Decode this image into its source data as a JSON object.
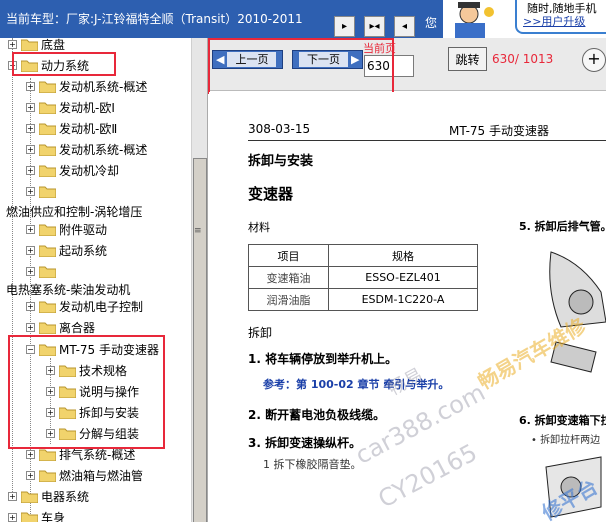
{
  "header": {
    "car_label": "当前车型：",
    "car_value": "厂家:J-江铃福特全顺（Transit）2010-2011",
    "about_text": "您",
    "ad_line1": "随时,随地手机",
    "ad_line2": ">>用户升级"
  },
  "toolbar_buttons": {
    "first_icon": "▸",
    "middle_icon": "▸◂",
    "last_icon": "◂"
  },
  "sidebar": {
    "items": [
      {
        "label": "底盘",
        "expander": "+"
      },
      {
        "label": "动力系统",
        "expander": "−"
      },
      {
        "label": "发动机系统-概述",
        "expander": "+"
      },
      {
        "label": "发动机-欧Ⅰ",
        "expander": "+"
      },
      {
        "label": "发动机-欧Ⅱ",
        "expander": "+"
      },
      {
        "label": "发动机系统-概述",
        "expander": "+"
      },
      {
        "label": "发动机冷却",
        "expander": "+"
      },
      {
        "label": "",
        "expander": "+"
      },
      {
        "label": "燃油供应和控制-涡轮增压",
        "expander": ""
      },
      {
        "label": "附件驱动",
        "expander": "+"
      },
      {
        "label": "起动系统",
        "expander": "+"
      },
      {
        "label": "",
        "expander": "+"
      },
      {
        "label": "电热塞系统-柴油发动机",
        "expander": ""
      },
      {
        "label": "发动机电子控制",
        "expander": "+"
      },
      {
        "label": "离合器",
        "expander": "+"
      },
      {
        "label": "MT-75 手动变速器",
        "expander": "−"
      },
      {
        "label": "技术规格",
        "expander": "+"
      },
      {
        "label": "说明与操作",
        "expander": "+"
      },
      {
        "label": "拆卸与安装",
        "expander": "+"
      },
      {
        "label": "分解与组装",
        "expander": "+"
      },
      {
        "label": "排气系统-概述",
        "expander": "+"
      },
      {
        "label": "燃油箱与燃油管",
        "expander": "+"
      },
      {
        "label": "电器系统",
        "expander": "+"
      },
      {
        "label": "车身",
        "expander": "+"
      }
    ]
  },
  "toolbar": {
    "prev_label": "上一页",
    "next_label": "下一页",
    "page_caption": "当前页",
    "page_value": "630",
    "jump_label": "跳转",
    "page_count": "630/ 1013",
    "zoom_icon": "+"
  },
  "document": {
    "doc_number": "308-03-15",
    "header_title": "MT-75 手动变速器",
    "section_title": "拆卸与安装",
    "component_title": "变速器",
    "materials_heading": "材料",
    "table_headers": [
      "项目",
      "规格"
    ],
    "table_rows": [
      [
        "变速箱油",
        "ESSO-EZL401"
      ],
      [
        "润滑油脂",
        "ESDM-1C220-A"
      ]
    ],
    "removal_heading": "拆卸",
    "step1": "1. 将车辆停放到举升机上。",
    "step1_ref": "参考：第 100-02 章节 牵引与举升。",
    "step2": "2. 断开蓄电池负极线缆。",
    "step3": "3. 拆卸变速操纵杆。",
    "step3_sub": "1 拆下橡胶隔音垫。",
    "right_step5": "5. 拆卸后排气管。",
    "right_step6": "6. 拆卸变速箱下拉",
    "right_step6_sub": "• 拆卸拉杆两边",
    "watermark1": "畅易",
    "watermark2": "car388.com",
    "watermark3": "CY20165",
    "watermark4": "畅易汽车维修",
    "watermark5": "修平台"
  },
  "colors": {
    "title_bar": "#2d5fb0",
    "highlight": "#e8283a",
    "nav_button": "#3f6fbf",
    "link_blue": "#1a3fa8"
  }
}
